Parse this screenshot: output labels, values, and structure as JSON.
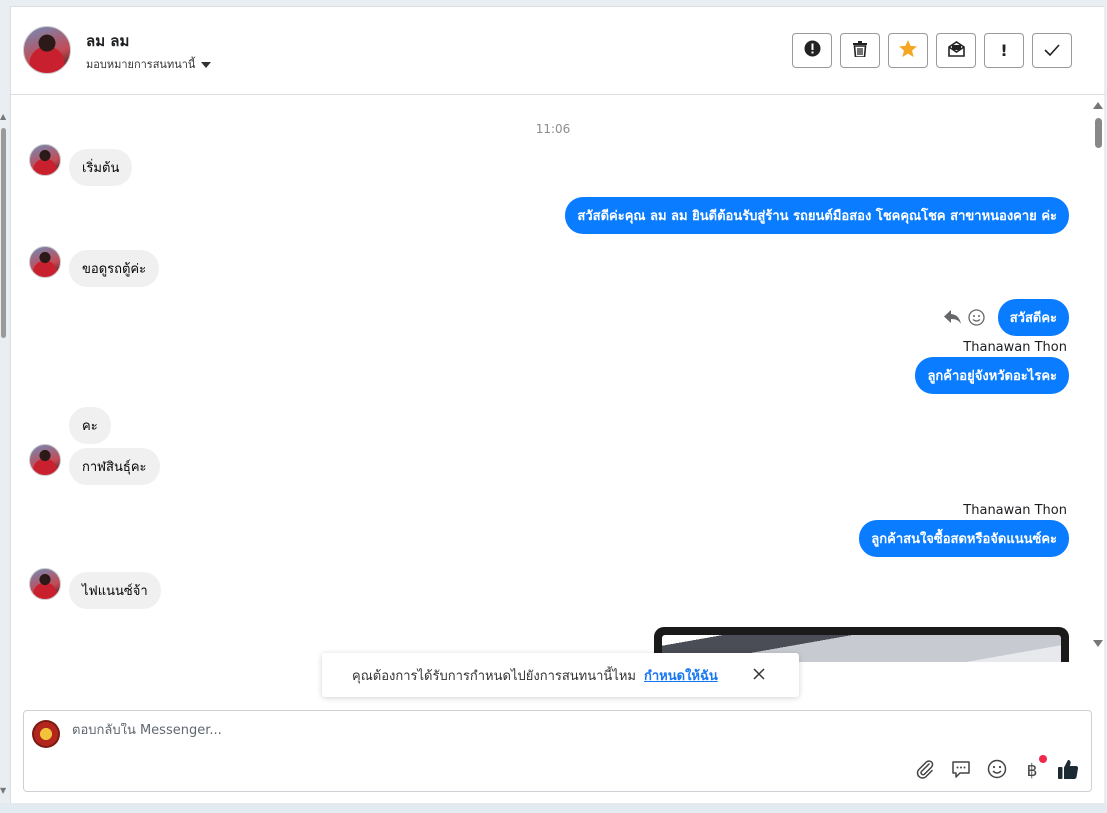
{
  "header": {
    "contact_name": "ลม ลม",
    "assign_label": "มอบหมายการสนทนานี้",
    "buttons": [
      {
        "name": "mark-spam-button",
        "icon": "alert-circle-icon",
        "glyph": "!"
      },
      {
        "name": "delete-button",
        "icon": "trash-icon",
        "glyph": "🗑"
      },
      {
        "name": "star-button",
        "icon": "star-icon",
        "glyph": "★"
      },
      {
        "name": "mark-unread-button",
        "icon": "envelope-open-icon",
        "glyph": "✉"
      },
      {
        "name": "follow-up-button",
        "icon": "exclamation-icon",
        "glyph": "!"
      },
      {
        "name": "mark-done-button",
        "icon": "check-icon",
        "glyph": "✓"
      }
    ]
  },
  "chat": {
    "timestamp": "11:06",
    "messages": [
      {
        "dir": "in",
        "text": "เริ่มต้น"
      },
      {
        "dir": "out",
        "text": "สวัสดีค่ะคุณ ลม ลม ยินดีต้อนรับสู่ร้าน รถยนต์มือสอง โชคคุณโชค สาขาหนองคาย ค่ะ"
      },
      {
        "dir": "in",
        "text": "ขอดูรถตู้ค่ะ"
      },
      {
        "dir": "out",
        "text": "สวัสดีคะ"
      },
      {
        "dir": "out",
        "sender": "Thanawan Thon",
        "text": "ลูกค้าอยู่จังหวัดอะไรคะ"
      },
      {
        "dir": "in",
        "text": "คะ"
      },
      {
        "dir": "in",
        "text": "กาฬสินธุ์คะ"
      },
      {
        "dir": "out",
        "sender": "Thanawan Thon",
        "text": "ลูกค้าสนใจซื้อสดหรือจัดแนนซ์คะ"
      },
      {
        "dir": "in",
        "text": "ไฟแนนซ์จ้า"
      }
    ]
  },
  "toast": {
    "text": "คุณต้องการได้รับการกำหนดไปยังการสนทนานี้ไหม",
    "link": "กำหนดให้ฉัน"
  },
  "composer": {
    "placeholder": "ตอบกลับใน Messenger..."
  },
  "colors": {
    "outgoing_bubble": "#0a7cff",
    "incoming_bubble": "#f0f0f0",
    "star": "#f5a623",
    "notification_dot": "#f0284a"
  }
}
